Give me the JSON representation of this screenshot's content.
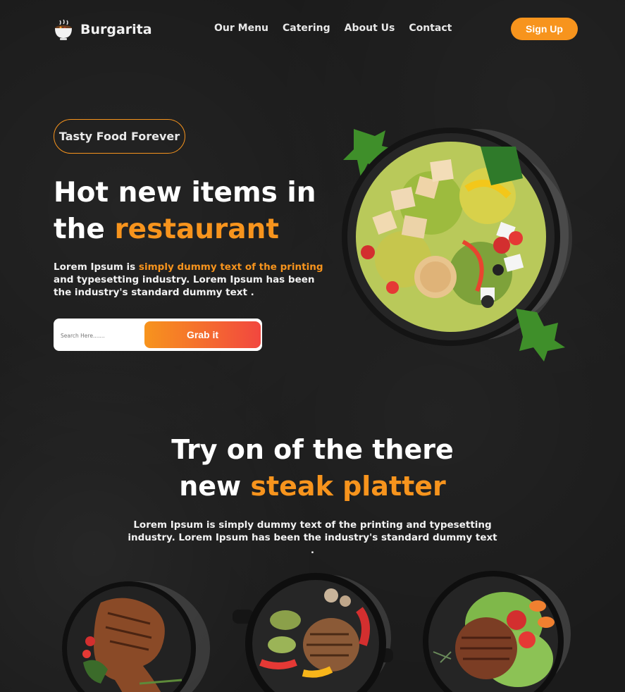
{
  "brand": {
    "name": "Burgarita"
  },
  "nav": {
    "items": [
      "Our Menu",
      "Catering",
      "About Us",
      "Contact"
    ],
    "signup_label": "Sign Up"
  },
  "hero": {
    "tag": "Tasty Food Forever",
    "title_line1": "Hot new items in",
    "title_line2_plain": "the ",
    "title_line2_accent": "restaurant",
    "desc_plain1": "Lorem Ipsum is ",
    "desc_accent": "simply dummy text of the printing",
    "desc_plain2": " and typesetting industry. Lorem Ipsum has been the industry's standard dummy text .",
    "search_placeholder": "Search Here.......",
    "button_label": "Grab it"
  },
  "section2": {
    "title_line1": "Try on of the there",
    "title_line2_plain": "new ",
    "title_line2_accent": "steak platter",
    "desc": "Lorem Ipsum is simply dummy text of the printing and typesetting industry. Lorem Ipsum has been the industry's standard dummy text ."
  },
  "colors": {
    "accent": "#f7941d",
    "accent_red": "#f2473f",
    "background": "#1b1b1b"
  },
  "icons": [
    "coffee-bowl-logo-icon"
  ],
  "images": [
    "salad-bowl-image",
    "grilled-steak-plate-image",
    "steak-vegetables-pan-image",
    "burger-patty-salad-plate-image"
  ]
}
